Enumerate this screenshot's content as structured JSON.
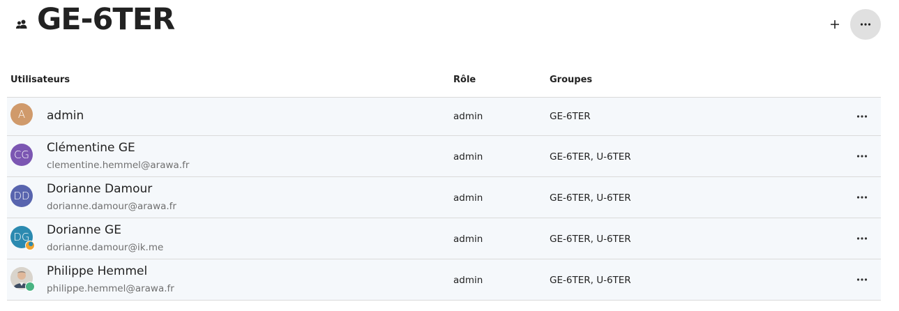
{
  "header": {
    "icon": "group-icon",
    "title": "GE-6TER",
    "add_icon": "plus-icon",
    "more_icon": "more-horizontal-icon"
  },
  "table": {
    "columns": [
      "Utilisateurs",
      "Rôle",
      "Groupes"
    ],
    "rows": [
      {
        "avatar": "A",
        "avatar_color": "#d09a6b",
        "name": "admin",
        "email": "",
        "role": "admin",
        "groups": "GE-6TER",
        "status": ""
      },
      {
        "avatar": "CG",
        "avatar_color": "#7b56b2",
        "name": "Clémentine GE",
        "email": "clementine.hemmel@arawa.fr",
        "role": "admin",
        "groups": "GE-6TER, U-6TER",
        "status": ""
      },
      {
        "avatar": "DD",
        "avatar_color": "#5864ae",
        "name": "Dorianne Damour",
        "email": "dorianne.damour@arawa.fr",
        "role": "admin",
        "groups": "GE-6TER, U-6TER",
        "status": ""
      },
      {
        "avatar": "DG",
        "avatar_color": "#2b8ab0",
        "name": "Dorianne GE",
        "email": "dorianne.damour@ik.me",
        "role": "admin",
        "groups": "GE-6TER, U-6TER",
        "status": "away"
      },
      {
        "avatar": "",
        "avatar_color": "#c9c3bb",
        "name": "Philippe Hemmel",
        "email": "philippe.hemmel@arawa.fr",
        "role": "admin",
        "groups": "GE-6TER, U-6TER",
        "status": "online"
      }
    ]
  },
  "colors": {
    "row_bg": "#f5f8fb",
    "away": "#f0a330",
    "online": "#49b382",
    "button_bg": "#e0e0e0"
  }
}
